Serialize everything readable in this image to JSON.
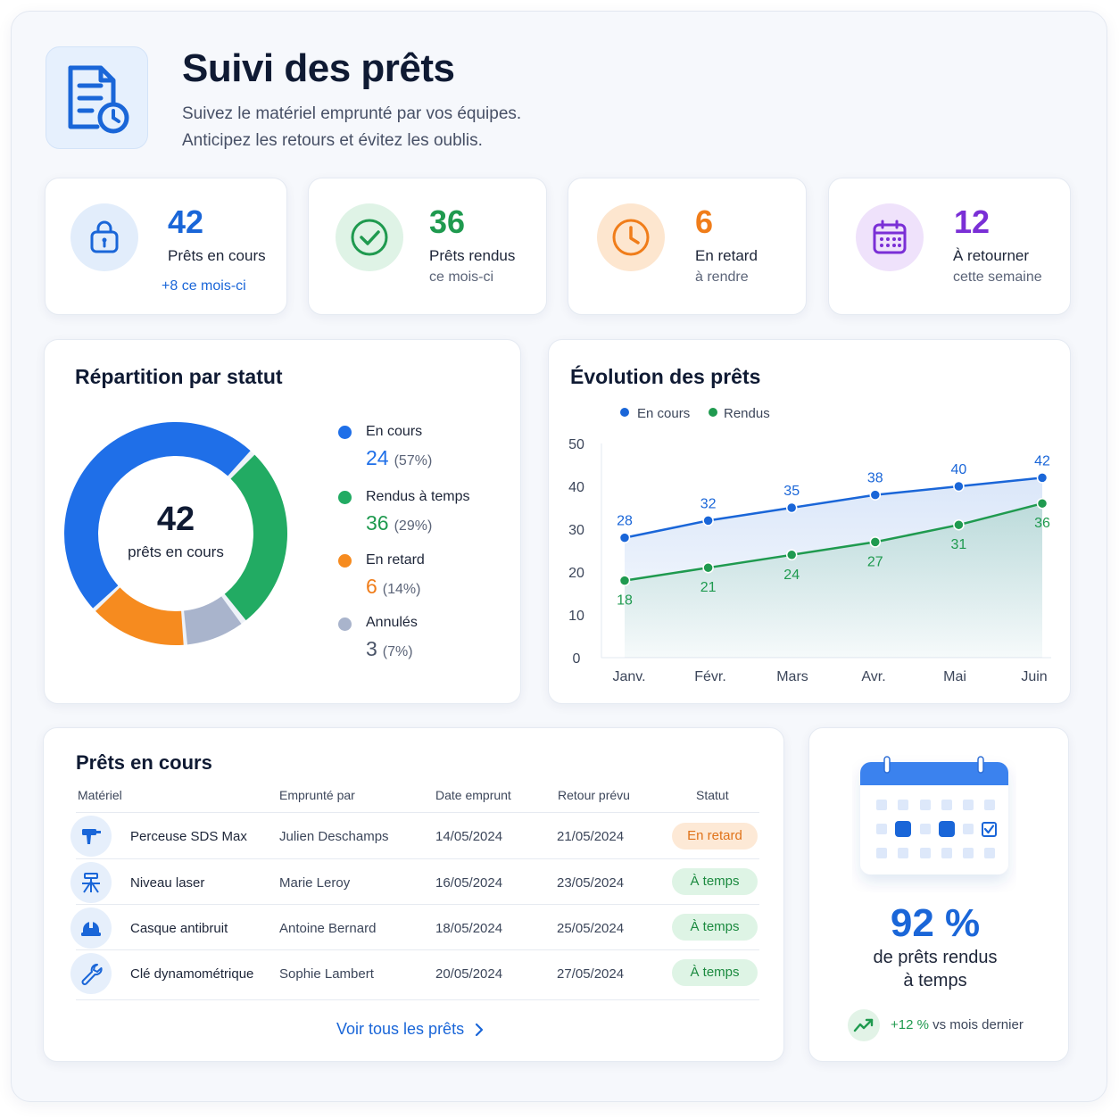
{
  "header": {
    "title": "Suivi des prêts",
    "subtitle_line1": "Suivez le matériel emprunté par vos équipes.",
    "subtitle_line2": "Anticipez les retours et évitez les oublis."
  },
  "stats": [
    {
      "value": "42",
      "label": "Prêts en cours",
      "sub": "+8 ce mois-ci",
      "color": "#1a66d8",
      "icon": "lock-icon"
    },
    {
      "value": "36",
      "label": "Prêts rendus",
      "sub": "ce mois-ci",
      "color": "#1f9a4f",
      "icon": "check-circle-icon"
    },
    {
      "value": "6",
      "label": "En retard",
      "sub": "à rendre",
      "color": "#f07d1a",
      "icon": "clock-icon"
    },
    {
      "value": "12",
      "label": "À retourner",
      "sub": "cette semaine",
      "color": "#7a2fd6",
      "icon": "calendar-icon"
    }
  ],
  "donut": {
    "title": "Répartition par statut",
    "center_value": "42",
    "center_label": "prêts en cours",
    "items": [
      {
        "name": "En cours",
        "value": "24",
        "pct": "(57%)",
        "color": "#1f6fe8"
      },
      {
        "name": "Rendus à temps",
        "value": "36",
        "pct": "(29%)",
        "color": "#22ab63"
      },
      {
        "name": "En retard",
        "value": "6",
        "pct": "(14%)",
        "color": "#f68b1f"
      },
      {
        "name": "Annulés",
        "value": "3",
        "pct": "(7%)",
        "color": "#a9b4cc"
      }
    ]
  },
  "chart_data": {
    "type": "line",
    "title": "Évolution des prêts",
    "categories": [
      "Janv.",
      "Févr.",
      "Mars",
      "Avr.",
      "Mai",
      "Juin"
    ],
    "series": [
      {
        "name": "En cours",
        "values": [
          28,
          32,
          35,
          38,
          40,
          42
        ],
        "color": "#1a66d8"
      },
      {
        "name": "Rendus",
        "values": [
          18,
          21,
          24,
          27,
          31,
          36
        ],
        "color": "#1f9a4f"
      }
    ],
    "ylim": [
      0,
      50
    ],
    "yticks": [
      "50",
      "40",
      "30",
      "20",
      "10",
      "0"
    ],
    "legend": "top-left",
    "grid": false
  },
  "table": {
    "title": "Prêts en cours",
    "headers": [
      "Matériel",
      "Emprunté par",
      "Date emprunt",
      "Retour prévu",
      "Statut"
    ],
    "rows": [
      {
        "item": "Perceuse SDS Max",
        "by": "Julien Deschamps",
        "date": "14/05/2024",
        "return": "21/05/2024",
        "status": "En retard",
        "icon": "drill-icon"
      },
      {
        "item": "Niveau laser",
        "by": "Marie Leroy",
        "date": "16/05/2024",
        "return": "23/05/2024",
        "status": "À temps",
        "icon": "laser-level-icon"
      },
      {
        "item": "Casque antibruit",
        "by": "Antoine Bernard",
        "date": "18/05/2024",
        "return": "25/05/2024",
        "status": "À temps",
        "icon": "helmet-icon"
      },
      {
        "item": "Clé dynamométrique",
        "by": "Sophie Lambert",
        "date": "20/05/2024",
        "return": "27/05/2024",
        "status": "À temps",
        "icon": "wrench-icon"
      }
    ],
    "see_all": "Voir tous les prêts"
  },
  "ontime": {
    "value": "92 %",
    "label_line1": "de prêts rendus",
    "label_line2": "à temps",
    "trend_value": "+12 %",
    "trend_text": "vs mois dernier"
  }
}
